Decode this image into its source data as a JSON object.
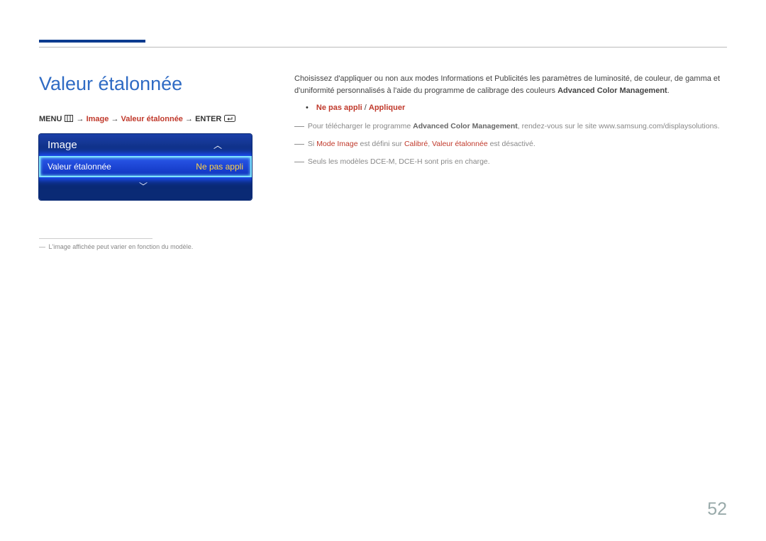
{
  "title": "Valeur étalonnée",
  "breadcrumb": {
    "menu": "MENU",
    "arrow": "→",
    "path1": "Image",
    "path2": "Valeur étalonnée",
    "enter": "ENTER"
  },
  "menu_box": {
    "header": "Image",
    "row_label": "Valeur étalonnée",
    "row_value": "Ne pas appli"
  },
  "left_footnote": "L'image affichée peut varier en fonction du modèle.",
  "body": {
    "p1a": "Choisissez d'appliquer ou non aux modes Informations et Publicités les paramètres de luminosité, de couleur, de gamma et d'uniformité personnalisés à l'aide du programme de calibrage des couleurs ",
    "p1b": "Advanced Color Management",
    "p1c": ".",
    "bullet_opt1": "Ne pas appli",
    "bullet_sep": " / ",
    "bullet_opt2": "Appliquer",
    "note1a": "Pour télécharger le programme ",
    "note1b": "Advanced Color Management",
    "note1c": ", rendez-vous sur le site www.samsung.com/displaysolutions.",
    "note2a": "Si ",
    "note2b": "Mode Image",
    "note2c": " est défini sur ",
    "note2d": "Calibré",
    "note2e": ", ",
    "note2f": "Valeur étalonnée",
    "note2g": " est désactivé.",
    "note3": "Seuls les modèles DCE-M, DCE-H sont pris en charge."
  },
  "page_number": "52"
}
